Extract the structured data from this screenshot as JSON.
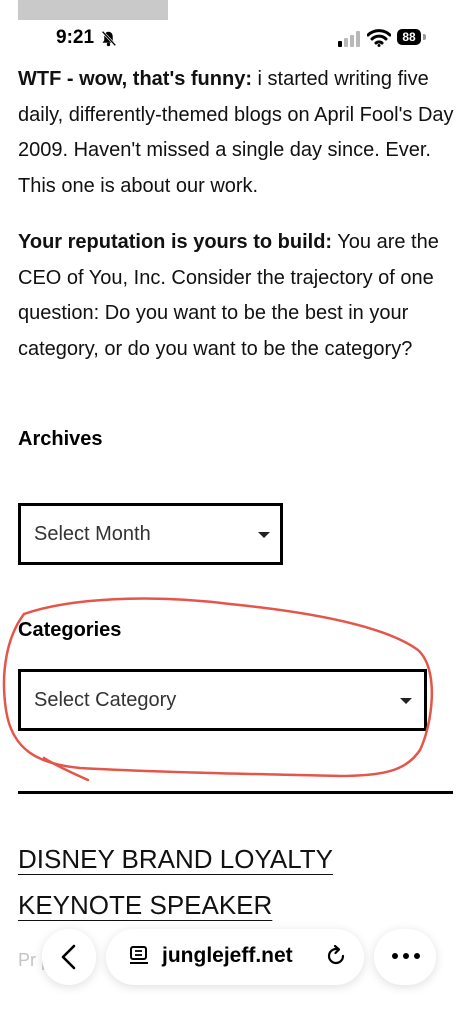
{
  "status_bar": {
    "time": "9:21",
    "battery": "88"
  },
  "paragraphs": [
    {
      "title": "WTF - wow, that's funny:",
      "text": " i started writing five daily, differently-themed blogs on April Fool's Day 2009. Haven't missed a single day since. Ever. This one is about our work."
    },
    {
      "title": "Your reputation is yours to build:",
      "text": " You are the CEO of You, Inc. Consider the trajectory of one question: Do you want to be the best in your category, or do you want to be the category?"
    }
  ],
  "archives": {
    "title": "Archives",
    "select_label": "Select Month"
  },
  "categories": {
    "title": "Categories",
    "select_label": "Select Category"
  },
  "post_link": "DISNEY BRAND LOYALTY KEYNOTE SPEAKER",
  "faded_text": "Pr    p",
  "browser": {
    "url": "junglejeff.net"
  },
  "colors": {
    "annotation": "#e4554a"
  },
  "icons": {
    "bell": "bell-slash-icon",
    "signal": "cellular-signal-icon",
    "wifi": "wifi-icon",
    "battery": "battery-icon",
    "back": "chevron-left-icon",
    "page": "page-menu-icon",
    "reload": "reload-icon",
    "more": "more-icon"
  }
}
